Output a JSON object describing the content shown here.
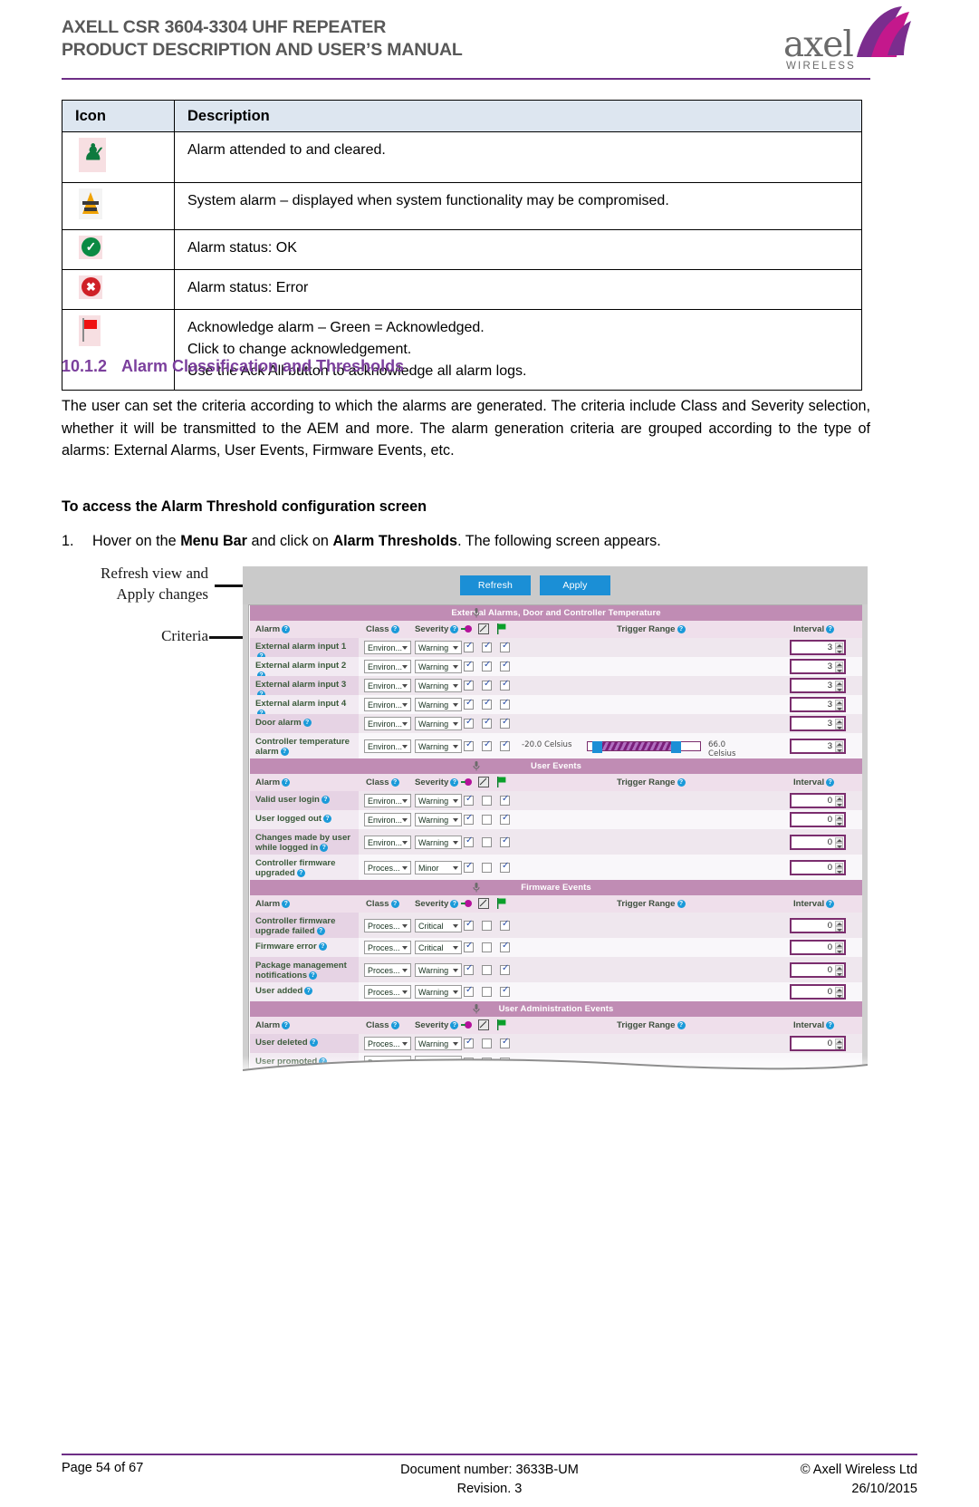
{
  "header": {
    "title_line1": "AXELL CSR 3604-3304 UHF REPEATER",
    "title_line2": "PRODUCT DESCRIPTION AND USER’S MANUAL",
    "logo_word": "axel",
    "logo_sub": "WIRELESS",
    "accent_color": "#6e2e86"
  },
  "icon_table": {
    "headers": [
      "Icon",
      "Description"
    ],
    "rows": [
      {
        "icon": "alarm-cleared-icon",
        "desc": "Alarm attended to and cleared."
      },
      {
        "icon": "system-alarm-icon",
        "desc": "System alarm – displayed when system functionality may be compromised."
      },
      {
        "icon": "status-ok-icon",
        "desc": "Alarm status: OK"
      },
      {
        "icon": "status-error-icon",
        "desc": "Alarm status: Error"
      },
      {
        "icon": "acknowledge-flag-icon",
        "desc_lines": [
          "Acknowledge alarm – Green = Acknowledged.",
          "Click to change acknowledgement.",
          "Use the Ack All button to acknowledge all alarm logs."
        ]
      }
    ]
  },
  "section": {
    "number": "10.1.2",
    "heading": "Alarm Classification and Thresholds",
    "paragraph": "The user can set the criteria according to which the alarms are generated. The criteria include Class and Severity selection, whether it will be transmitted to the AEM and more. The alarm generation criteria are grouped according to the type of alarms: External Alarms, User Events, Firmware Events, etc.",
    "bold_lead": "To access the Alarm Threshold configuration screen",
    "step_index": "1.",
    "step_parts": [
      "Hover on the ",
      "Menu Bar",
      " and click on ",
      "Alarm Thresholds",
      ". The following screen appears."
    ]
  },
  "callouts": {
    "refresh_apply": "Refresh view and\nApply changes",
    "criteria": "Criteria"
  },
  "app": {
    "toolbar": {
      "refresh": "Refresh",
      "apply": "Apply"
    },
    "column_headers": {
      "alarm": "Alarm",
      "class": "Class",
      "severity": "Severity",
      "icon1": "aem-transmit-icon",
      "icon2": "log-icon",
      "icon3": "flag-icon",
      "trigger_range": "Trigger Range",
      "interval": "Interval"
    },
    "sections": [
      {
        "title": "External Alarms, Door and Controller Temperature",
        "rows": [
          {
            "name": "External alarm input 1",
            "class": "Environ...",
            "severity": "Warning",
            "cb1": true,
            "cb2": true,
            "cb3": true,
            "interval": "3",
            "range": null
          },
          {
            "name": "External alarm input 2",
            "class": "Environ...",
            "severity": "Warning",
            "cb1": true,
            "cb2": true,
            "cb3": true,
            "interval": "3",
            "range": null
          },
          {
            "name": "External alarm input 3",
            "class": "Environ...",
            "severity": "Warning",
            "cb1": true,
            "cb2": true,
            "cb3": true,
            "interval": "3",
            "range": null
          },
          {
            "name": "External alarm input 4",
            "class": "Environ...",
            "severity": "Warning",
            "cb1": true,
            "cb2": true,
            "cb3": true,
            "interval": "3",
            "range": null
          },
          {
            "name": "Door alarm",
            "class": "Environ...",
            "severity": "Warning",
            "cb1": true,
            "cb2": true,
            "cb3": true,
            "interval": "3",
            "range": null
          },
          {
            "name": "Controller temperature alarm",
            "class": "Environ...",
            "severity": "Warning",
            "cb1": true,
            "cb2": true,
            "cb3": true,
            "interval": "3",
            "range": {
              "low": "-20.0  Celsius",
              "high": "66.0  Celsius"
            }
          }
        ]
      },
      {
        "title": "User Events",
        "rows": [
          {
            "name": "Valid user login",
            "class": "Environ...",
            "severity": "Warning",
            "cb1": true,
            "cb2": false,
            "cb3": true,
            "interval": "0",
            "range": null
          },
          {
            "name": "User logged out",
            "class": "Environ...",
            "severity": "Warning",
            "cb1": true,
            "cb2": false,
            "cb3": true,
            "interval": "0",
            "range": null
          },
          {
            "name": "Changes made by user while logged in",
            "class": "Environ...",
            "severity": "Warning",
            "cb1": true,
            "cb2": false,
            "cb3": true,
            "interval": "0",
            "range": null
          },
          {
            "name": "Controller firmware upgraded",
            "class": "Proces...",
            "severity": "Minor",
            "cb1": true,
            "cb2": false,
            "cb3": true,
            "interval": "0",
            "range": null
          }
        ]
      },
      {
        "title": "Firmware Events",
        "rows": [
          {
            "name": "Controller firmware upgrade failed",
            "class": "Proces...",
            "severity": "Critical",
            "cb1": true,
            "cb2": false,
            "cb3": true,
            "interval": "0",
            "range": null
          },
          {
            "name": "Firmware error",
            "class": "Proces...",
            "severity": "Critical",
            "cb1": true,
            "cb2": false,
            "cb3": true,
            "interval": "0",
            "range": null
          },
          {
            "name": "Package management notifications",
            "class": "Proces...",
            "severity": "Warning",
            "cb1": true,
            "cb2": false,
            "cb3": true,
            "interval": "0",
            "range": null
          },
          {
            "name": "User added",
            "class": "Proces...",
            "severity": "Warning",
            "cb1": true,
            "cb2": false,
            "cb3": true,
            "interval": "0",
            "range": null
          }
        ]
      },
      {
        "title": "User Administration Events",
        "rows": [
          {
            "name": "User deleted",
            "class": "Proces...",
            "severity": "Warning",
            "cb1": true,
            "cb2": false,
            "cb3": true,
            "interval": "0",
            "range": null
          },
          {
            "name": "User promoted",
            "class": "Proces...",
            "severity": "Warning",
            "cb1": false,
            "cb2": false,
            "cb3": false,
            "interval": "",
            "range": null
          }
        ]
      }
    ]
  },
  "footer": {
    "page": "Page 54 of 67",
    "doc_line1": "Document number: 3633B-UM",
    "doc_line2": "Revision. 3",
    "copy_line1": "© Axell Wireless Ltd",
    "copy_line2": "26/10/2015"
  }
}
